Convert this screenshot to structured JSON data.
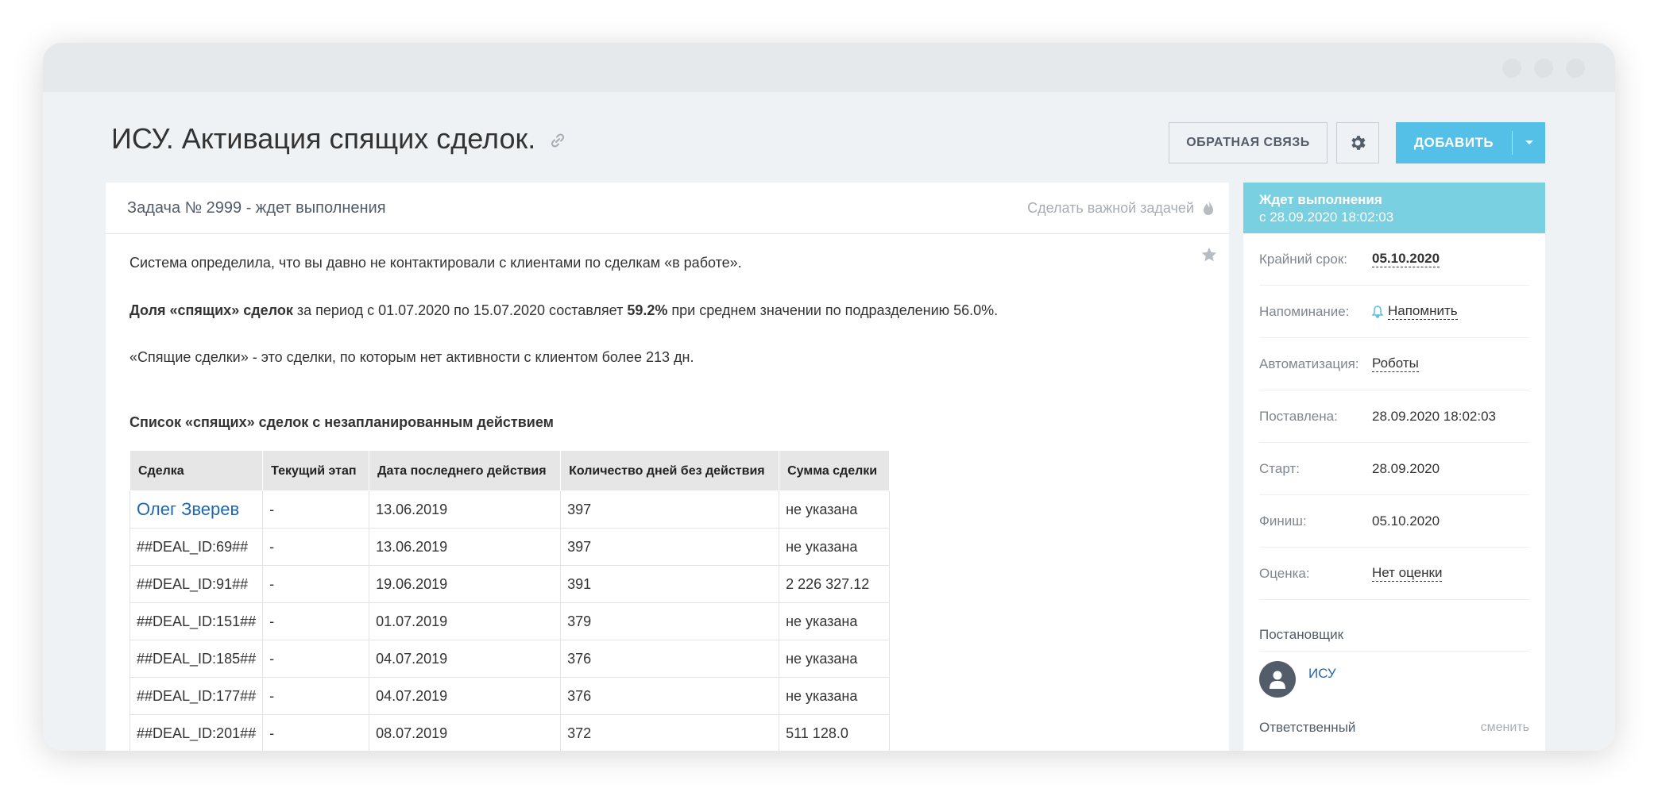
{
  "page": {
    "title": "ИСУ. Активация спящих сделок.",
    "feedback_label": "ОБРАТНАЯ СВЯЗЬ",
    "add_label": "ДОБАВИТЬ"
  },
  "task": {
    "title": "Задача № 2999 - ждет выполнения",
    "important_label": "Сделать важной задачей",
    "p1": "Система определила, что вы давно не контактировали с клиентами по сделкам «в работе».",
    "p2_bold": "Доля «спящих» сделок",
    "p2_text1": " за период с 01.07.2020 по 15.07.2020 составляет ",
    "p2_value": "59.2%",
    "p2_text2": " при среднем значении по подразделению 56.0%.",
    "p3": "«Спящие сделки» - это сделки, по которым нет активности с клиентом более 213 дн.",
    "list_title": "Список «спящих» сделок с незапланированным действием",
    "table": {
      "headers": [
        "Сделка",
        "Текущий этап",
        "Дата последнего действия",
        "Количество дней без действия",
        "Сумма сделки"
      ],
      "rows": [
        [
          "Олег Зверев",
          "-",
          "13.06.2019",
          "397",
          "не указана"
        ],
        [
          "##DEAL_ID:69##",
          "-",
          "13.06.2019",
          "397",
          "не указана"
        ],
        [
          "##DEAL_ID:91##",
          "-",
          "19.06.2019",
          "391",
          "2 226 327.12"
        ],
        [
          "##DEAL_ID:151##",
          "-",
          "01.07.2019",
          "379",
          "не указана"
        ],
        [
          "##DEAL_ID:185##",
          "-",
          "04.07.2019",
          "376",
          "не указана"
        ],
        [
          "##DEAL_ID:177##",
          "-",
          "04.07.2019",
          "376",
          "не указана"
        ],
        [
          "##DEAL_ID:201##",
          "-",
          "08.07.2019",
          "372",
          "511 128.0"
        ]
      ]
    }
  },
  "sidebar": {
    "status_title": "Ждет выполнения",
    "status_since": "с 28.09.2020 18:02:03",
    "rows": [
      {
        "key": "Крайний срок:",
        "value": "05.10.2020"
      },
      {
        "key": "Напоминание:",
        "value": "Напомнить"
      },
      {
        "key": "Автоматизация:",
        "value": "Роботы"
      },
      {
        "key": "Поставлена:",
        "value": "28.09.2020 18:02:03"
      },
      {
        "key": "Старт:",
        "value": "28.09.2020"
      },
      {
        "key": "Финиш:",
        "value": "05.10.2020"
      },
      {
        "key": "Оценка:",
        "value": "Нет оценки"
      }
    ],
    "creator_title": "Постановщик",
    "creator_name": "ИСУ",
    "responsible_title": "Ответственный",
    "change_label": "сменить"
  },
  "colors": {
    "accent": "#55c0e7",
    "status": "#78d0e1",
    "link": "#2067b0"
  }
}
